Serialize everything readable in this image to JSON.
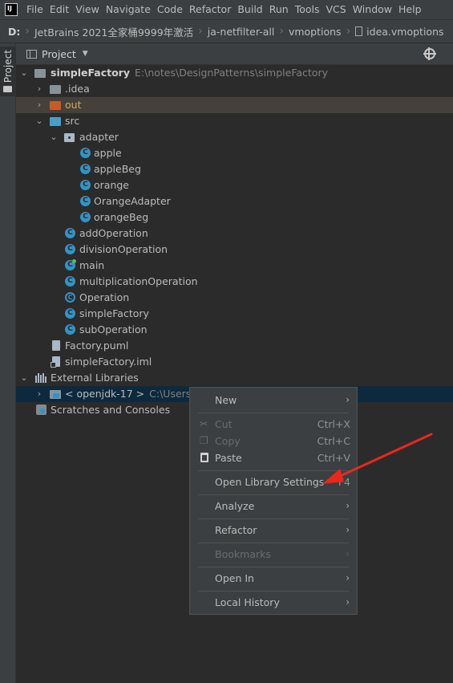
{
  "app": {
    "logo_text": "IJ"
  },
  "menubar": {
    "items": [
      "File",
      "Edit",
      "View",
      "Navigate",
      "Code",
      "Refactor",
      "Build",
      "Run",
      "Tools",
      "VCS",
      "Window",
      "Help"
    ]
  },
  "breadcrumb": {
    "items": [
      "D:",
      "JetBrains 2021全家桶9999年激活",
      "ja-netfilter-all",
      "vmoptions",
      "idea.vmoptions"
    ]
  },
  "side_tab": {
    "label": "Project"
  },
  "panel": {
    "title": "Project"
  },
  "tree": {
    "root": {
      "name": "simpleFactory",
      "path": "E:\\notes\\DesignPatterns\\simpleFactory"
    },
    "idea": ".idea",
    "out": "out",
    "src": "src",
    "adapter": "adapter",
    "adapter_classes": [
      "apple",
      "appleBeg",
      "orange",
      "OrangeAdapter",
      "orangeBeg"
    ],
    "classes": [
      "addOperation",
      "divisionOperation",
      "main",
      "multiplicationOperation",
      "Operation",
      "simpleFactory",
      "subOperation"
    ],
    "files": [
      "Factory.puml",
      "simpleFactory.iml"
    ],
    "external_libraries": "External Libraries",
    "jdk": {
      "name": "< openjdk-17 >",
      "path": "C:\\Users\\"
    },
    "scratches": "Scratches and Consoles"
  },
  "context_menu": {
    "new": "New",
    "cut": "Cut",
    "cut_shortcut": "Ctrl+X",
    "copy": "Copy",
    "copy_shortcut": "Ctrl+C",
    "paste": "Paste",
    "paste_shortcut": "Ctrl+V",
    "open_library_settings": "Open Library Settings",
    "open_library_settings_shortcut": "F4",
    "analyze": "Analyze",
    "refactor": "Refactor",
    "bookmarks": "Bookmarks",
    "open_in": "Open In",
    "local_history": "Local History"
  },
  "colors": {
    "annotation_arrow": "#e8281c",
    "selection": "#0d293e",
    "accent": "#3592c4"
  }
}
